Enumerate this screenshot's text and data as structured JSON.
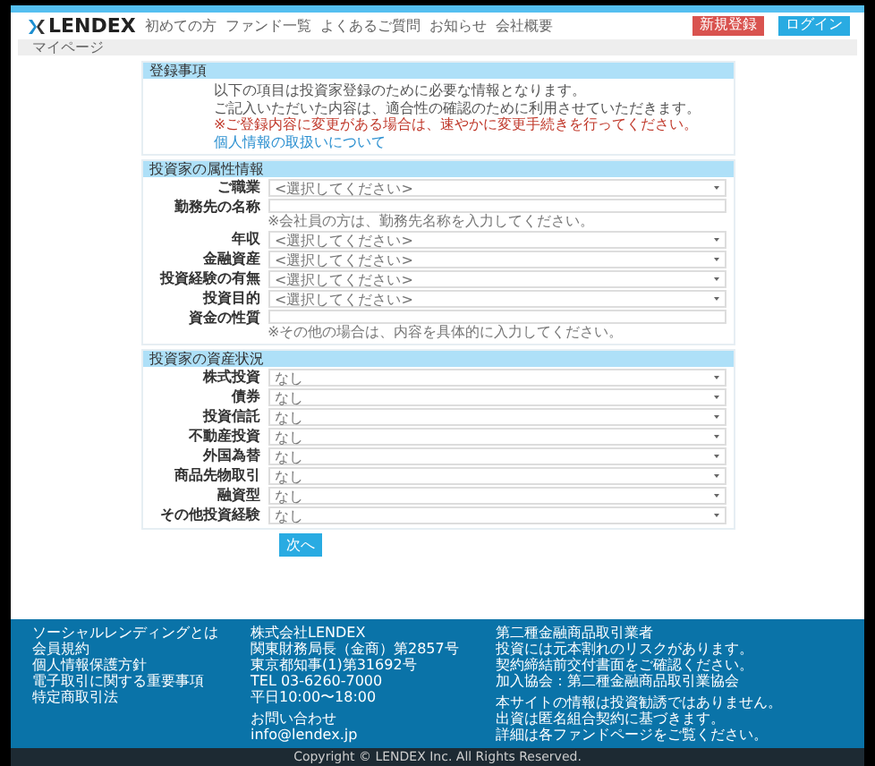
{
  "header": {
    "logo": "LENDEX",
    "nav": [
      "初めての方",
      "ファンド一覧",
      "よくあるご質問",
      "お知らせ",
      "会社概要"
    ],
    "buttons": [
      {
        "label": "新規登録",
        "kind": "danger"
      },
      {
        "label": "ログイン",
        "kind": "primary"
      }
    ]
  },
  "breadcrumb": "マイページ",
  "sections": [
    {
      "title": "登録事項",
      "kind": "notice",
      "lines": [
        {
          "text": "以下の項目は投資家登録のために必要な情報となります。",
          "kind": "plain"
        },
        {
          "text": "ご記入いただいた内容は、適合性の確認のために利用させていただきます。",
          "kind": "plain"
        },
        {
          "text": "※ご登録内容に変更がある場合は、速やかに変更手続きを行ってください。",
          "kind": "warning"
        },
        {
          "text": "個人情報の取扱いについて",
          "kind": "link"
        }
      ]
    },
    {
      "title": "投資家の属性情報",
      "kind": "form",
      "rows": [
        {
          "label": "ご職業",
          "kind": "select",
          "value": "<選択してください>"
        },
        {
          "label": "勤務先の名称",
          "kind": "textarea",
          "note": "※会社員の方は、勤務先名称を入力してください。"
        },
        {
          "label": "年収",
          "kind": "select",
          "value": "<選択してください>"
        },
        {
          "label": "金融資産",
          "kind": "select",
          "value": "<選択してください>"
        },
        {
          "label": "投資経験の有無",
          "kind": "select",
          "value": "<選択してください>"
        },
        {
          "label": "投資目的",
          "kind": "select",
          "value": "<選択してください>"
        },
        {
          "label": "資金の性質",
          "kind": "textarea",
          "note": "※その他の場合は、内容を具体的に入力してください。"
        }
      ]
    },
    {
      "title": "投資家の資産状況",
      "kind": "form",
      "rows": [
        {
          "label": "株式投資",
          "kind": "select",
          "value": "なし"
        },
        {
          "label": "債券",
          "kind": "select",
          "value": "なし"
        },
        {
          "label": "投資信託",
          "kind": "select",
          "value": "なし"
        },
        {
          "label": "不動産投資",
          "kind": "select",
          "value": "なし"
        },
        {
          "label": "外国為替",
          "kind": "select",
          "value": "なし"
        },
        {
          "label": "商品先物取引",
          "kind": "select",
          "value": "なし"
        },
        {
          "label": "融資型",
          "kind": "select",
          "value": "なし"
        },
        {
          "label": "その他投資経験",
          "kind": "select",
          "value": "なし"
        }
      ]
    }
  ],
  "submit": "次へ",
  "footer": {
    "links": [
      "ソーシャルレンディングとは",
      "会員規約",
      "個人情報保護方針",
      "電子取引に関する重要事項",
      "特定商取引法"
    ],
    "company": [
      "株式会社LENDEX",
      "関東財務局長（金商）第2857号",
      "東京都知事(1)第31692号",
      "TEL 03-6260-7000",
      "平日10:00〜18:00"
    ],
    "company2": [
      "お問い合わせ",
      "info@lendex.jp"
    ],
    "notes": [
      "第二種金融商品取引業者",
      "投資には元本割れのリスクがあります。",
      "契約締結前交付書面をご確認ください。",
      "加入協会：第二種金融商品取引業協会"
    ],
    "notes2": [
      "本サイトの情報は投資勧誘ではありません。",
      "出資は匿名組合契約に基づきます。",
      "詳細は各ファンドページをご覧ください。"
    ],
    "copyright": "Copyright © LENDEX Inc. All Rights Reserved."
  }
}
